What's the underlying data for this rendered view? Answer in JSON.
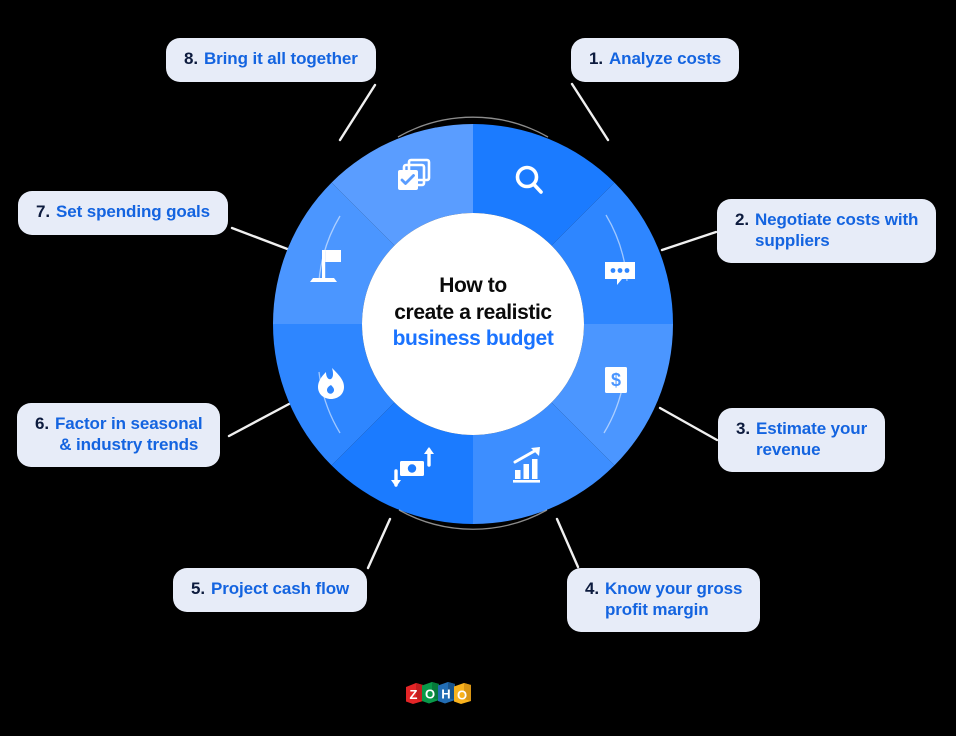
{
  "page": {
    "background_color": "#000000",
    "title_lines": [
      "How to",
      "create a realistic",
      "business budget"
    ],
    "accent_color": "#1a73ff",
    "label_bg_color": "#e7ecf8",
    "label_num_color": "#0d1b3e",
    "label_text_color": "#1464e0"
  },
  "center": {
    "line1": "How to",
    "line2": "create a realistic",
    "line3": "business budget"
  },
  "steps": [
    {
      "num": "1.",
      "text": "Analyze costs",
      "icon": "search-icon",
      "segment_color": "#1b7bff"
    },
    {
      "num": "2.",
      "text": "Negotiate costs with\nsuppliers",
      "icon": "chat-bubble-icon",
      "segment_color": "#2e86ff"
    },
    {
      "num": "3.",
      "text": "Estimate your\nrevenue",
      "icon": "dollar-bill-icon",
      "segment_color": "#4b96ff"
    },
    {
      "num": "4.",
      "text": "Know your gross\nprofit margin",
      "icon": "bar-chart-growth-icon",
      "segment_color": "#3d8eff"
    },
    {
      "num": "5.",
      "text": "Project cash flow",
      "icon": "cash-flow-icon",
      "segment_color": "#1b7bff"
    },
    {
      "num": "6.",
      "text": "Factor in seasonal\n& industry trends",
      "icon": "flame-icon",
      "segment_color": "#2e86ff"
    },
    {
      "num": "7.",
      "text": "Set spending goals",
      "icon": "flag-icon",
      "segment_color": "#4b96ff"
    },
    {
      "num": "8.",
      "text": "Bring it all together",
      "icon": "stacked-cards-check-icon",
      "segment_color": "#5a9dff"
    }
  ],
  "brand": {
    "name": "ZOHO",
    "letters": [
      {
        "char": "Z",
        "color": "#e42527"
      },
      {
        "char": "O",
        "color": "#089949"
      },
      {
        "char": "H",
        "color": "#226db4"
      },
      {
        "char": "O",
        "color": "#f9b21d"
      }
    ]
  },
  "chart_data": {
    "type": "pie",
    "title": "How to create a realistic business budget",
    "categories": [
      "Analyze costs",
      "Negotiate costs with suppliers",
      "Estimate your revenue",
      "Know your gross profit margin",
      "Project cash flow",
      "Factor in seasonal & industry trends",
      "Set spending goals",
      "Bring it all together"
    ],
    "values": [
      12.5,
      12.5,
      12.5,
      12.5,
      12.5,
      12.5,
      12.5,
      12.5
    ],
    "colors": [
      "#1b7bff",
      "#2e86ff",
      "#4b96ff",
      "#3d8eff",
      "#1b7bff",
      "#2e86ff",
      "#4b96ff",
      "#5a9dff"
    ],
    "legend": "none",
    "donut": true,
    "xlabel": "",
    "ylabel": ""
  }
}
